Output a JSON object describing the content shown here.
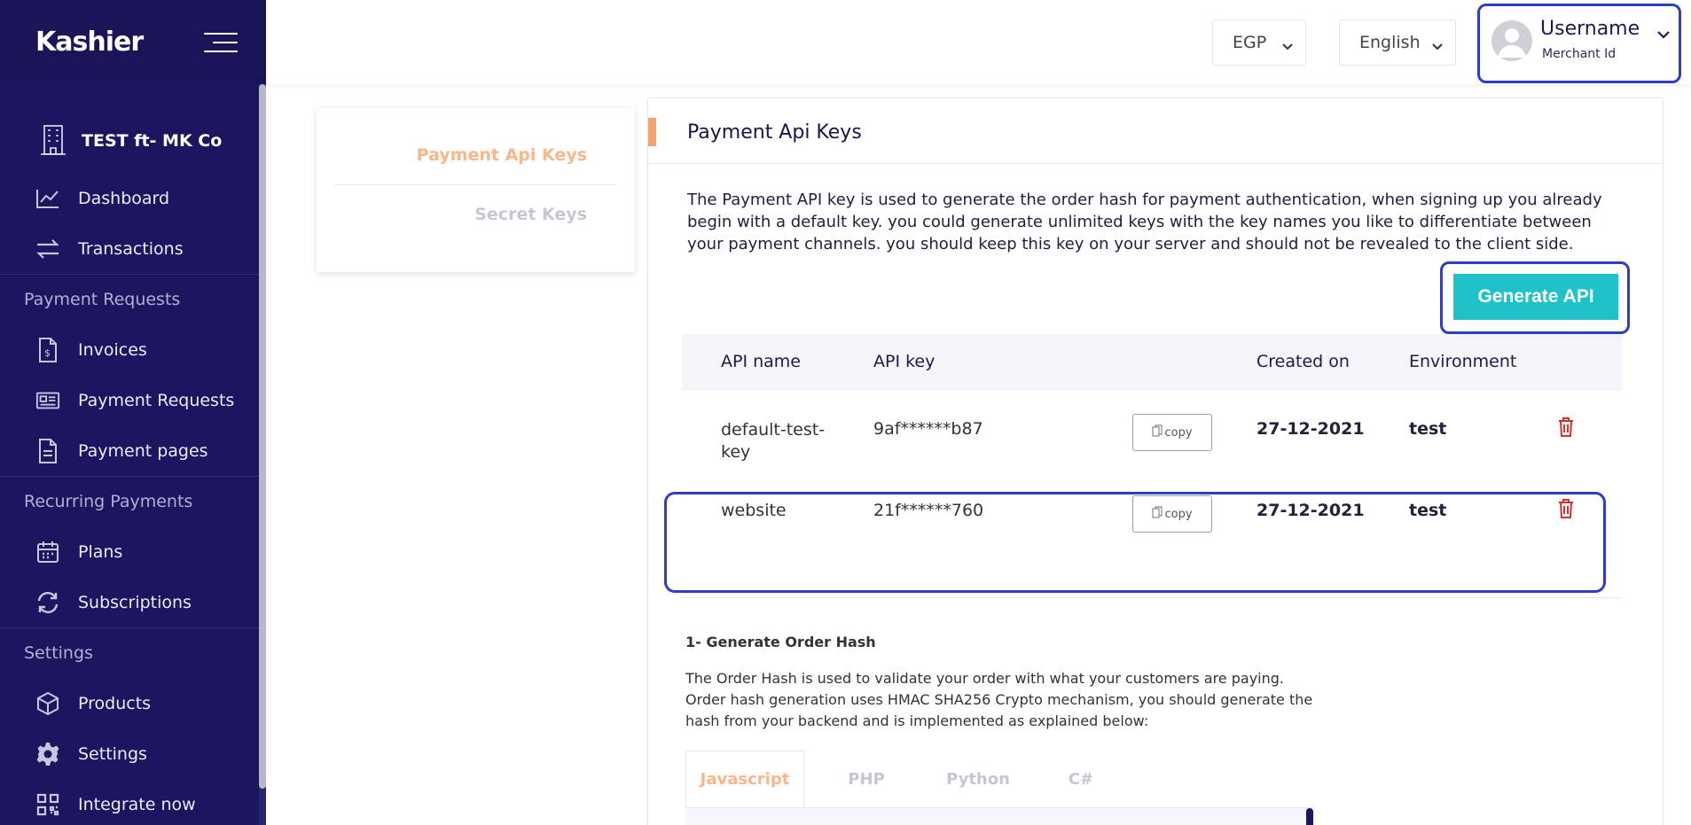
{
  "brand": {
    "logo": "Kashier"
  },
  "sidebar": {
    "company": "TEST ft- MK Co",
    "items": [
      {
        "label": "Dashboard",
        "icon": "chart-line-icon"
      },
      {
        "label": "Transactions",
        "icon": "arrows-exchange-icon"
      },
      {
        "section": "Payment Requests"
      },
      {
        "label": "Invoices",
        "icon": "invoice-icon"
      },
      {
        "label": "Payment Requests",
        "icon": "newspaper-icon"
      },
      {
        "label": "Payment pages",
        "icon": "page-icon"
      },
      {
        "section": "Recurring Payments"
      },
      {
        "label": "Plans",
        "icon": "calendar-icon"
      },
      {
        "label": "Subscriptions",
        "icon": "refresh-icon"
      },
      {
        "section": "Settings"
      },
      {
        "label": "Products",
        "icon": "box-icon"
      },
      {
        "label": "Settings",
        "icon": "gear-icon"
      },
      {
        "label": "Integrate now",
        "icon": "qr-code-icon"
      }
    ]
  },
  "header": {
    "currency": "EGP",
    "language": "English",
    "username": "Username",
    "merchant_id": "Merchant Id"
  },
  "tabs": {
    "active": "Payment Api Keys",
    "inactive": "Secret Keys"
  },
  "card": {
    "title": "Payment Api Keys",
    "description": "The Payment API key is used to generate the order hash for payment authentication, when signing up you already begin with a default key. you could generate unlimited keys with the key names you like to differentiate between your payment channels. you should keep this key on your server and should not be revealed to the client side.",
    "generate_label": "Generate API"
  },
  "table": {
    "headers": [
      "API name",
      "API key",
      "Created on",
      "Environment"
    ],
    "copy_label": "copy",
    "rows": [
      {
        "name_line1": "default-test-",
        "name_line2": "key",
        "key": "9af******b87",
        "created": "27-12-2021",
        "env": "test"
      },
      {
        "name_line1": "website",
        "name_line2": "",
        "key": "21f******760",
        "created": "27-12-2021",
        "env": "test"
      }
    ]
  },
  "section": {
    "title": "1- Generate Order Hash",
    "description": "The Order Hash is used to validate your order with what your customers are paying. Order hash generation uses HMAC SHA256 Crypto mechanism, you should generate the hash from your backend and is implemented as explained below:"
  },
  "code_tabs": [
    "Javascript",
    "PHP",
    "Python",
    "C#"
  ],
  "colors": {
    "sidebar_bg": "#1c1660",
    "accent": "#f9a16b",
    "active_tab": "#f9b68a",
    "button": "#20c2c9",
    "highlight": "#2f3cc4",
    "danger": "#d0312d"
  }
}
